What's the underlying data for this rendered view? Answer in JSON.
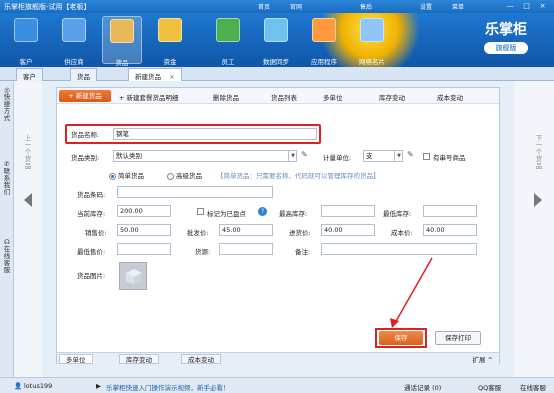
{
  "window": {
    "title": "乐掌柜旗舰版-试用【老板】",
    "links": [
      "首页",
      "官网",
      "售后",
      "设置",
      "菜单"
    ],
    "min": "—",
    "max": "□",
    "close": "×"
  },
  "toolbar": {
    "items": [
      {
        "label": "客户",
        "icon": "customer-icon"
      },
      {
        "label": "供应商",
        "icon": "supplier-icon"
      },
      {
        "label": "货品",
        "icon": "goods-icon"
      },
      {
        "label": "资金",
        "icon": "money-icon"
      },
      {
        "label": "员工",
        "icon": "staff-icon"
      },
      {
        "label": "数据同步",
        "icon": "sync-icon"
      },
      {
        "label": "应用程序",
        "icon": "app-icon"
      },
      {
        "label": "网络名片",
        "icon": "card-icon"
      }
    ],
    "brand": "乐掌柜",
    "edition": "旗舰版"
  },
  "tabs": [
    {
      "label": "客户"
    },
    {
      "label": "货品"
    },
    {
      "label": "新建货品",
      "close": "×"
    }
  ],
  "sidebar": {
    "items": [
      "快捷方式",
      "联系我们",
      "在线客服"
    ]
  },
  "nav": {
    "prev": "上一个货品",
    "next": "下一个货品"
  },
  "actions": {
    "new": "+ 新建货品",
    "new_with_detail": "+ 新建套餐货品明细",
    "delete": "删除货品",
    "list": "货品列表",
    "multi_unit": "多单位",
    "stock_change": "库存变动",
    "cost_change": "成本变动"
  },
  "form": {
    "name_label": "货品名称:",
    "name_value": "钢笔",
    "category_label": "货品类别:",
    "category_value": "默认类别",
    "unit_label": "计量单位:",
    "unit_value": "支",
    "serial_label": "有串号商品",
    "type_simple": "简单货品",
    "type_advanced": "高级货品",
    "type_hint": "【简单货品：只需要名称、代码就可以管理库存的货品】",
    "code_label": "货品条码:",
    "code_value": "",
    "stock_label": "当前库存:",
    "stock_value": "200.00",
    "mark_label": "标记为已盘点",
    "max_stock_label": "最高库存:",
    "max_stock_value": "",
    "min_stock_label": "最低库存:",
    "min_stock_value": "",
    "sale_label": "销售价:",
    "sale_value": "50.00",
    "wholesale_label": "批发价:",
    "wholesale_value": "45.00",
    "purchase_label": "进货价:",
    "purchase_value": "40.00",
    "cost_label": "成本价:",
    "cost_value": "40.00",
    "min_sale_label": "最低售价:",
    "min_sale_value": "",
    "location_label": "货源:",
    "location_value": "",
    "note_label": "备注:",
    "note_value": "",
    "image_label": "货品图片:"
  },
  "buttons": {
    "save": "保存",
    "save_print": "保存打印"
  },
  "bottom_tabs": [
    "多单位",
    "库存变动",
    "成本变动"
  ],
  "expand": "扩展 ^",
  "status": {
    "user": "lotus199",
    "tip": "乐掌柜快速入门操作演示视频，新手必看！",
    "call_log": "通话记录 (0)",
    "qq": "QQ客服",
    "service": "在线客服"
  },
  "colors": {
    "accent": "#1a6cc0",
    "save": "#d8621e",
    "highlight": "#e02020"
  }
}
